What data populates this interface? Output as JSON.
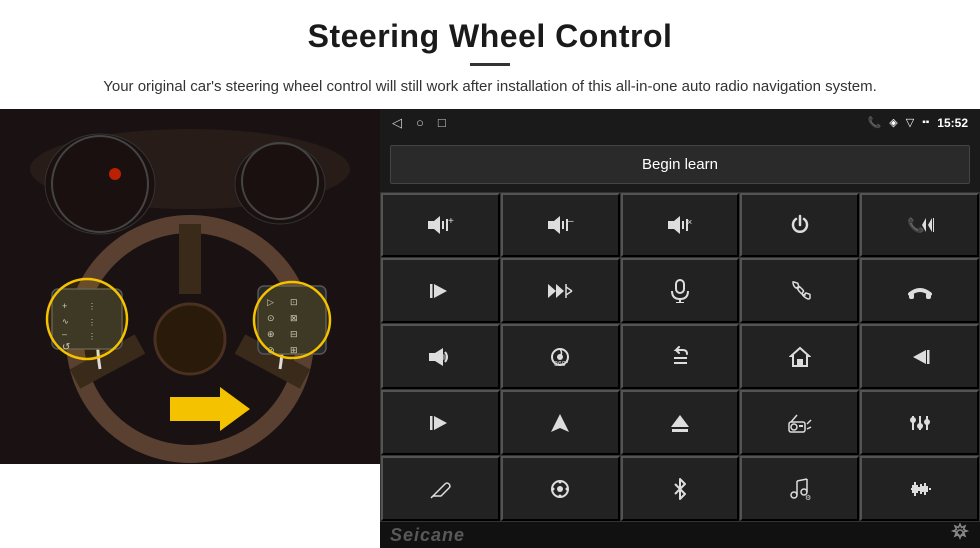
{
  "header": {
    "title": "Steering Wheel Control",
    "subtitle": "Your original car's steering wheel control will still work after installation of this all-in-one auto radio navigation system."
  },
  "status_bar": {
    "time": "15:52",
    "nav_icons": [
      "◁",
      "○",
      "□"
    ]
  },
  "begin_learn": {
    "label": "Begin learn"
  },
  "watermark": {
    "text": "Seicane"
  },
  "control_buttons": [
    {
      "id": "vol-up",
      "icon": "🔊+",
      "label": "Volume Up"
    },
    {
      "id": "vol-down",
      "icon": "🔉−",
      "label": "Volume Down"
    },
    {
      "id": "mute",
      "icon": "🔇",
      "label": "Mute"
    },
    {
      "id": "power",
      "icon": "⏻",
      "label": "Power"
    },
    {
      "id": "prev-track-call",
      "icon": "↤",
      "label": "Prev Track / Call"
    },
    {
      "id": "next-track",
      "icon": "⏭",
      "label": "Next Track"
    },
    {
      "id": "ff-skip",
      "icon": "⏩✕",
      "label": "Fast Forward Skip"
    },
    {
      "id": "mic",
      "icon": "🎙",
      "label": "Microphone"
    },
    {
      "id": "phone",
      "icon": "📞",
      "label": "Phone"
    },
    {
      "id": "hang-up",
      "icon": "↩",
      "label": "Hang Up"
    },
    {
      "id": "horn",
      "icon": "📣",
      "label": "Horn / Alert"
    },
    {
      "id": "cam360",
      "icon": "⟳",
      "label": "360 Camera"
    },
    {
      "id": "back",
      "icon": "↩",
      "label": "Back"
    },
    {
      "id": "home",
      "icon": "⌂",
      "label": "Home"
    },
    {
      "id": "rew",
      "icon": "⏮",
      "label": "Rewind"
    },
    {
      "id": "fast-fwd",
      "icon": "⏭",
      "label": "Fast Forward"
    },
    {
      "id": "navigate",
      "icon": "▲",
      "label": "Navigate"
    },
    {
      "id": "eject",
      "icon": "⏏",
      "label": "Eject"
    },
    {
      "id": "radio-rec",
      "icon": "📻",
      "label": "Radio Record"
    },
    {
      "id": "sliders",
      "icon": "⚙",
      "label": "Settings Sliders"
    },
    {
      "id": "pen-mic",
      "icon": "✏",
      "label": "Pen / Voice"
    },
    {
      "id": "settings-knob",
      "icon": "⚙",
      "label": "Settings Knob"
    },
    {
      "id": "bluetooth",
      "icon": "₿",
      "label": "Bluetooth"
    },
    {
      "id": "music-note",
      "icon": "♫",
      "label": "Music"
    },
    {
      "id": "waveform",
      "icon": "≋",
      "label": "Waveform / EQ"
    }
  ]
}
